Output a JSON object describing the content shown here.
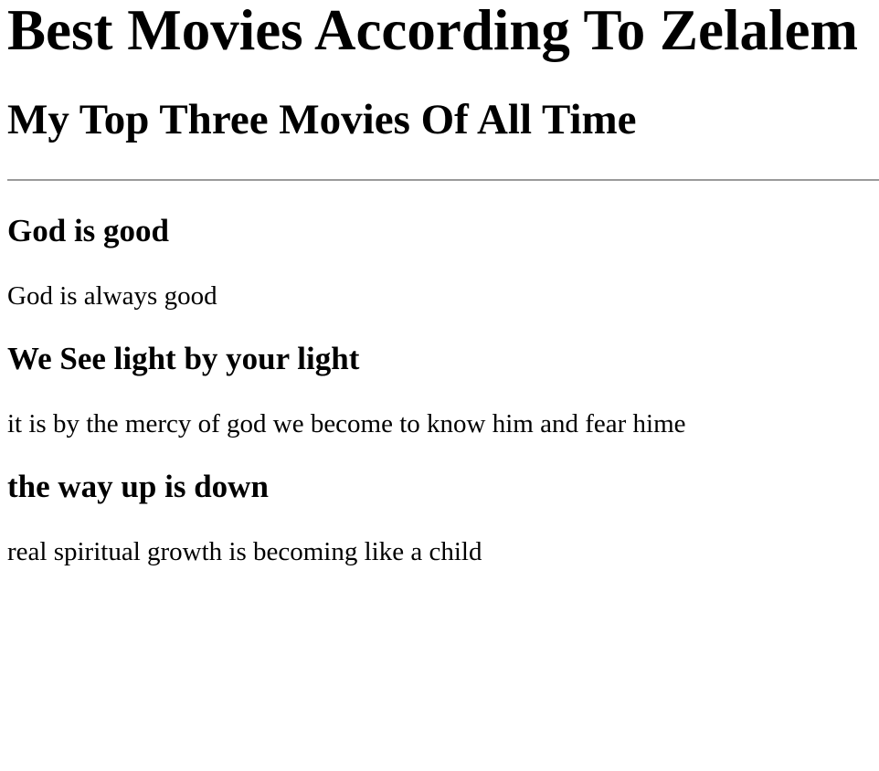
{
  "page": {
    "title": "Best Movies According To Zelalem",
    "subtitle": "My Top Three Movies Of All Time"
  },
  "movies": [
    {
      "title": "God is good",
      "description": "God is always good"
    },
    {
      "title": "We See light by your light",
      "description": "it is by the mercy of god we become to know him and fear hime"
    },
    {
      "title": "the way up is down",
      "description": "real spiritual growth is becoming like a child"
    }
  ],
  "colors": {
    "background": "#ffffff",
    "text": "#000000",
    "divider": "#9a9a9a"
  }
}
